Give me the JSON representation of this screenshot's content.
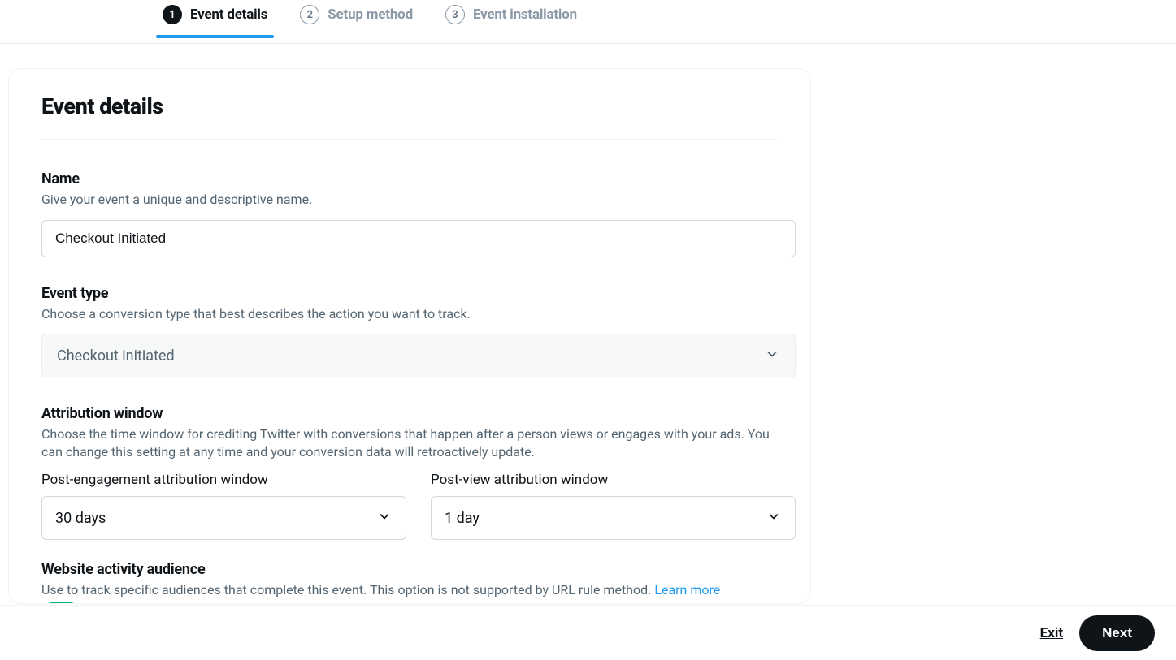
{
  "stepper": {
    "steps": [
      {
        "num": "1",
        "label": "Event details",
        "active": true
      },
      {
        "num": "2",
        "label": "Setup method",
        "active": false
      },
      {
        "num": "3",
        "label": "Event installation",
        "active": false
      }
    ]
  },
  "card": {
    "title": "Event details",
    "name": {
      "label": "Name",
      "desc": "Give your event a unique and descriptive name.",
      "value": "Checkout Initiated"
    },
    "event_type": {
      "label": "Event type",
      "desc": "Choose a conversion type that best describes the action you want to track.",
      "selected": "Checkout initiated"
    },
    "attribution": {
      "label": "Attribution window",
      "desc": "Choose the time window for crediting Twitter with conversions that happen after a person views or engages with your ads. You can change this setting at any time and your conversion data will retroactively update.",
      "post_engagement_label": "Post-engagement attribution window",
      "post_engagement_value": "30 days",
      "post_view_label": "Post-view attribution window",
      "post_view_value": "1 day"
    },
    "audience": {
      "label": "Website activity audience",
      "desc_pre": "Use to track specific audiences that complete this event. This option is not supported by URL rule method. ",
      "learn_more": "Learn more",
      "toggle_state": "On"
    }
  },
  "footer": {
    "exit": "Exit",
    "next": "Next"
  }
}
